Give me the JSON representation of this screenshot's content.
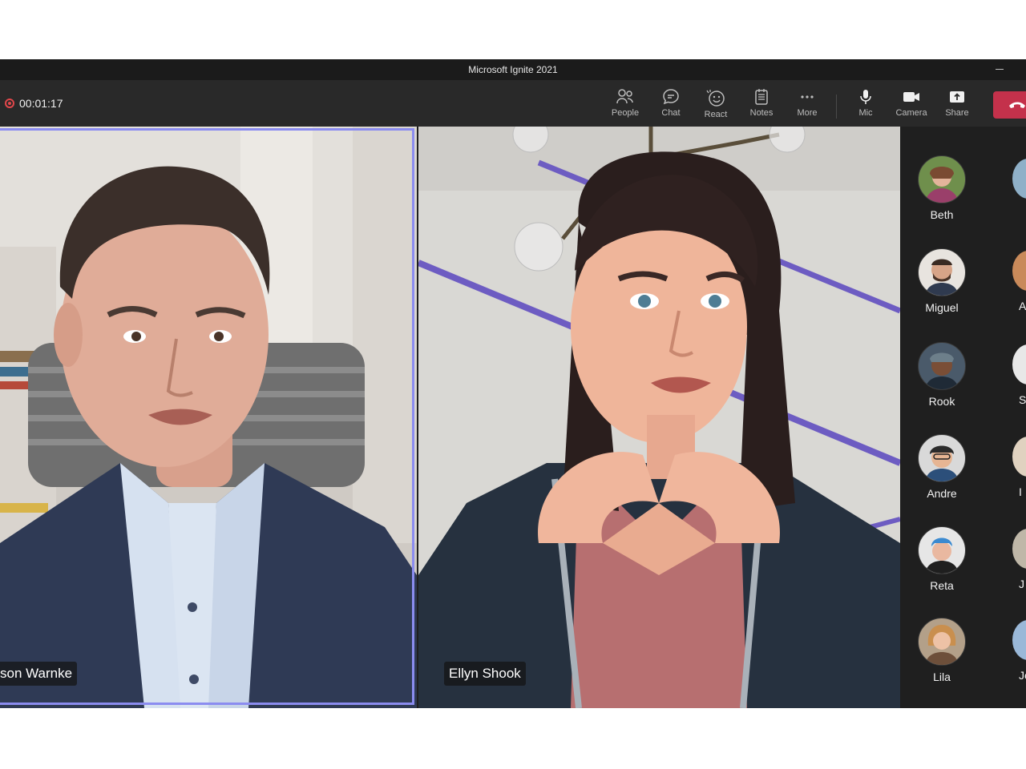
{
  "window": {
    "title": "Microsoft Ignite 2021"
  },
  "toolbar": {
    "timer": "00:01:17",
    "buttons": {
      "people": "People",
      "chat": "Chat",
      "react": "React",
      "notes": "Notes",
      "more": "More",
      "mic": "Mic",
      "camera": "Camera",
      "share": "Share"
    },
    "hangup_color": "#c4314b"
  },
  "stage": {
    "left_participant": "son Warnke",
    "right_participant": "Ellyn Shook",
    "active_speaker_border": "#8b8cf0"
  },
  "roster": {
    "people": [
      {
        "name": "Beth"
      },
      {
        "name": "Miguel"
      },
      {
        "name": "Rook"
      },
      {
        "name": "Andre"
      },
      {
        "name": "Reta"
      },
      {
        "name": "Lila"
      }
    ],
    "edge_letters": [
      "A",
      "Sa",
      "I",
      "J",
      "Je"
    ]
  }
}
